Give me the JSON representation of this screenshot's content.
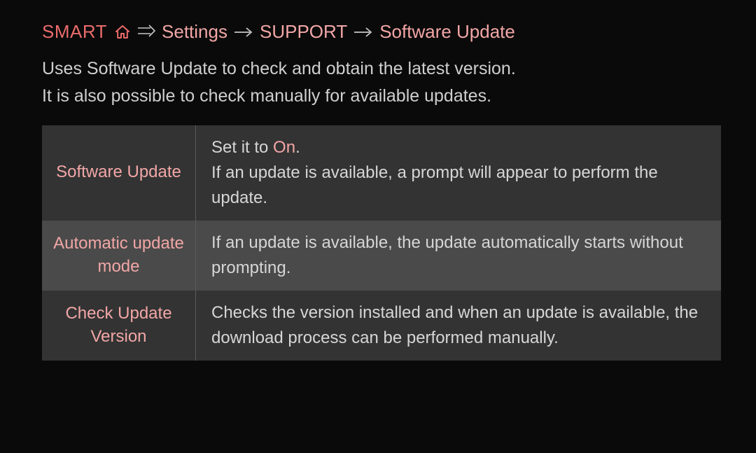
{
  "breadcrumb": {
    "smart": "SMART",
    "settings": "Settings",
    "support": "SUPPORT",
    "software_update": "Software Update"
  },
  "intro": {
    "line1": "Uses Software Update to check and obtain the latest version.",
    "line2": "It is also possible to check manually for available updates."
  },
  "table": {
    "rows": [
      {
        "label": "Software Update",
        "desc_pre": "Set it to ",
        "desc_on": "On",
        "desc_post": ".",
        "desc_rest": "If an update is available, a prompt will appear to perform the update."
      },
      {
        "label": "Automatic update mode",
        "desc": "If an update is available, the update automatically starts without prompting."
      },
      {
        "label": "Check Update Version",
        "desc": "Checks the version installed and when an update is available, the download process can be performed manually."
      }
    ]
  },
  "colors": {
    "accent": "#f2a6a6",
    "accent_strong": "#e96b6b",
    "bg": "#0a0a0a",
    "row_a": "#333333",
    "row_b": "#4a4a4a",
    "text": "#d6d6d6"
  }
}
